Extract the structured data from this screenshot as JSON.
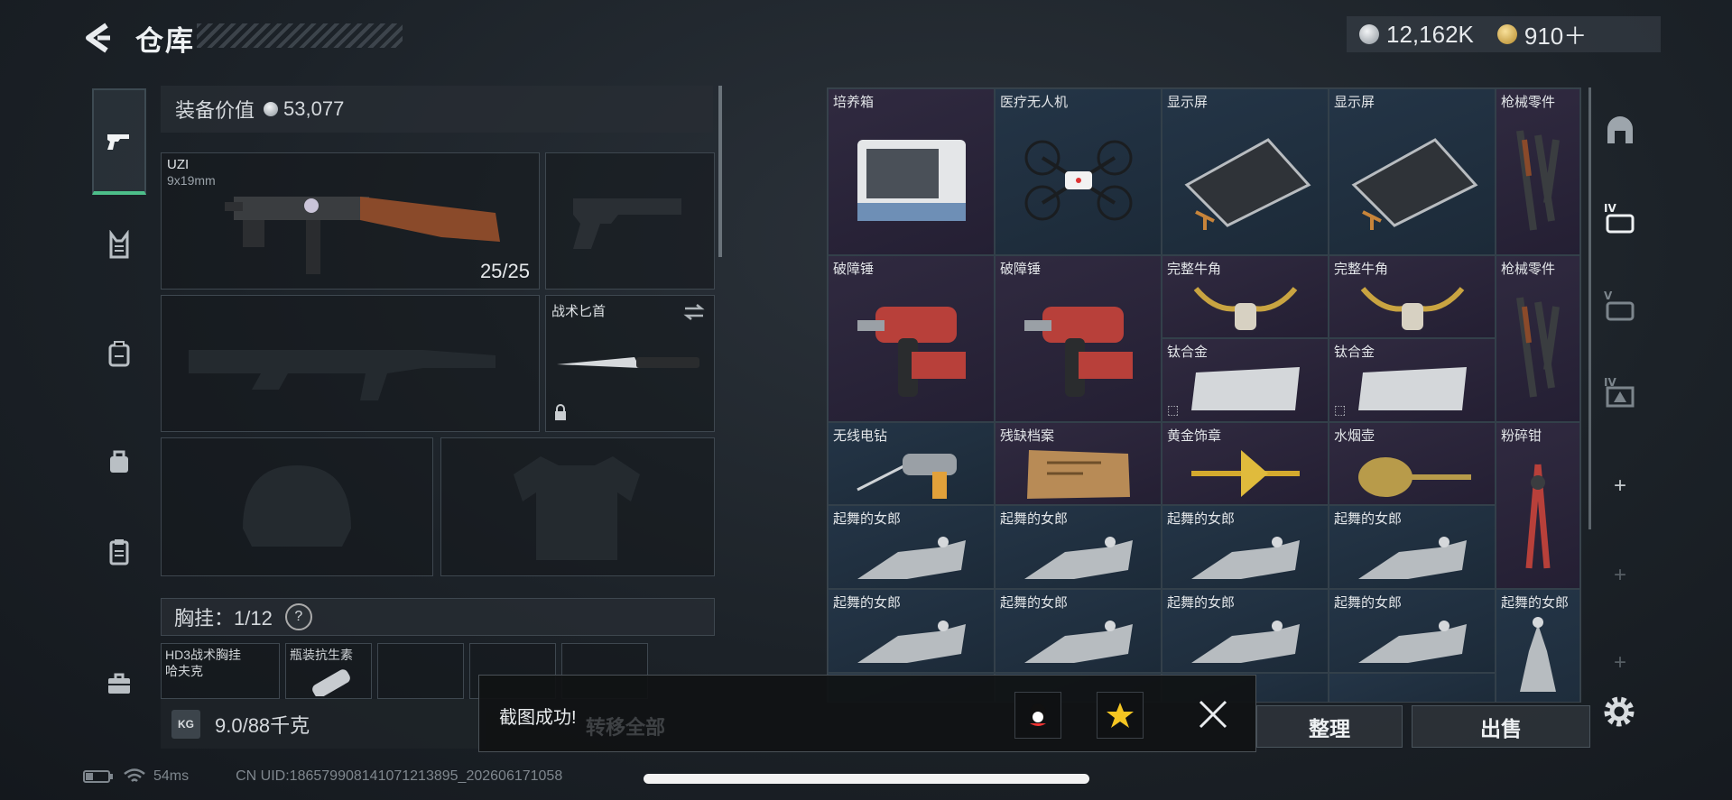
{
  "header": {
    "title": "仓库",
    "silver": "12,162K",
    "gold": "910＋"
  },
  "equipment": {
    "value_label": "装备价值",
    "value": "53,077",
    "primary": {
      "name": "UZI",
      "caliber": "9x19mm",
      "ammo": "25/25"
    },
    "melee": {
      "name": "战术匕首"
    },
    "vest_label": "胸挂：1/12",
    "vest_help": "?",
    "vest_items": [
      {
        "name": "HD3战术胸挂",
        "sub": "哈夫克"
      },
      {
        "name": "瓶装抗生素",
        "sub": ""
      }
    ],
    "weight": "9.0/88千克",
    "kg_tag": "KG"
  },
  "grid": [
    {
      "name": "培养箱"
    },
    {
      "name": "医疗无人机"
    },
    {
      "name": "显示屏"
    },
    {
      "name": "显示屏"
    },
    {
      "name": "枪械零件"
    },
    {
      "name": "破障锤"
    },
    {
      "name": "破障锤"
    },
    {
      "name": "完整牛角"
    },
    {
      "name": "完整牛角"
    },
    {
      "name": "枪械零件"
    },
    {
      "name": "钛合金"
    },
    {
      "name": "钛合金"
    },
    {
      "name": "无线电钻"
    },
    {
      "name": "残缺档案"
    },
    {
      "name": "黄金饰章"
    },
    {
      "name": "水烟壶"
    },
    {
      "name": "粉碎钳"
    },
    {
      "name": "起舞的女郎"
    },
    {
      "name": "起舞的女郎"
    },
    {
      "name": "起舞的女郎"
    },
    {
      "name": "起舞的女郎"
    },
    {
      "name": "起舞的女郎"
    },
    {
      "name": "起舞的女郎"
    },
    {
      "name": "起舞的女郎"
    },
    {
      "name": "起舞的女郎"
    },
    {
      "name": "起舞的女郎"
    }
  ],
  "right_tools": [
    "IV",
    "V",
    "IV",
    "+",
    "+",
    "+"
  ],
  "buttons": {
    "transfer_all": "转移全部",
    "sort": "整理",
    "sell": "出售"
  },
  "toast": {
    "message": "截图成功!"
  },
  "status": {
    "ping": "54ms",
    "uid": "CN UID:1865799081410712138​95_202606171058"
  }
}
